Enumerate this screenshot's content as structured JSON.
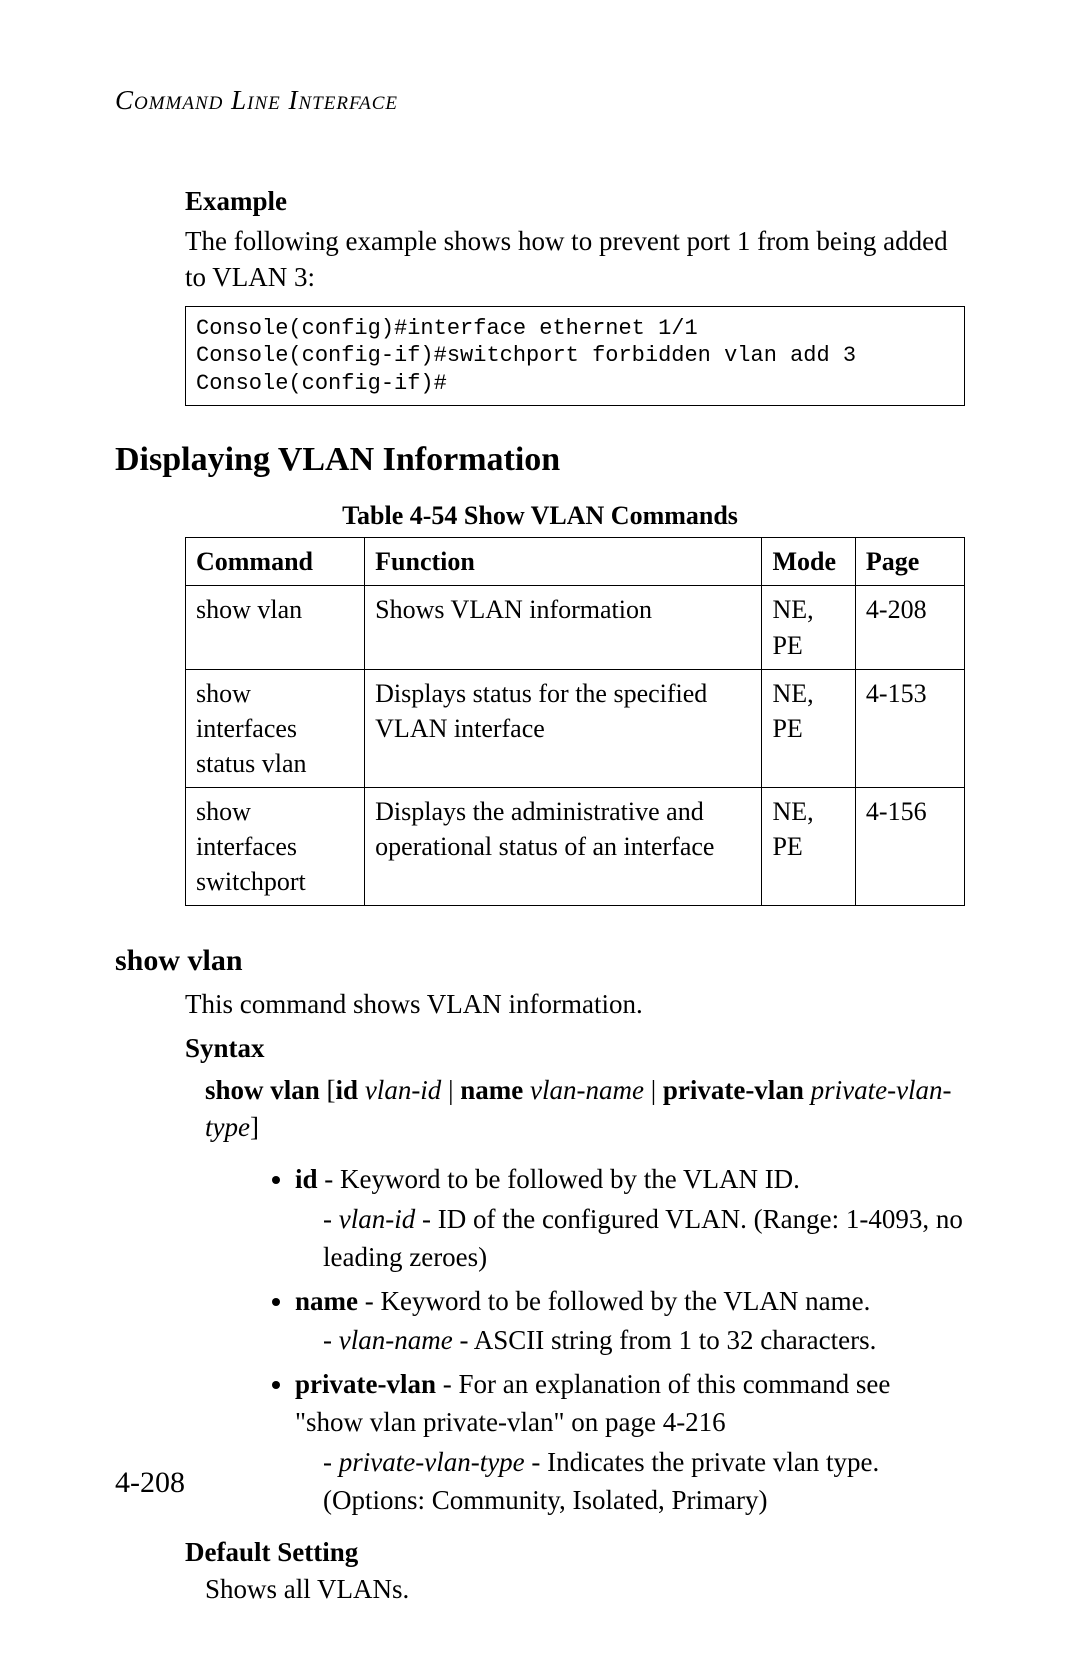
{
  "running_head": "Command Line Interface",
  "example": {
    "heading": "Example",
    "intro": "The following example shows how to prevent port 1 from being added to VLAN 3:",
    "code": "Console(config)#interface ethernet 1/1\nConsole(config-if)#switchport forbidden vlan add 3\nConsole(config-if)#"
  },
  "section_title": "Displaying VLAN Information",
  "table": {
    "caption": "Table 4-54  Show VLAN Commands",
    "headers": {
      "c0": "Command",
      "c1": "Function",
      "c2": "Mode",
      "c3": "Page"
    },
    "rows": [
      {
        "c0": "show vlan",
        "c1": "Shows VLAN information",
        "c2": "NE, PE",
        "c3": "4-208"
      },
      {
        "c0": "show interfaces status vlan",
        "c1": "Displays status for the specified VLAN interface",
        "c2": "NE, PE",
        "c3": "4-153"
      },
      {
        "c0": "show interfaces switchport",
        "c1": "Displays the administrative and operational status of an interface",
        "c2": "NE, PE",
        "c3": "4-156"
      }
    ]
  },
  "show_vlan": {
    "heading": "show vlan",
    "desc": "This command shows VLAN information.",
    "syntax_heading": "Syntax",
    "syntax": {
      "p1": "show vlan",
      "p2": " [",
      "p3": "id",
      "p4": " ",
      "p5": "vlan-id",
      "p6": " | ",
      "p7": "name",
      "p8": " ",
      "p9": "vlan-name",
      "p10": " | ",
      "p11": "private-vlan",
      "p12": " ",
      "p13": "private-vlan-type",
      "p14": "]"
    },
    "bullets": {
      "id_kw": "id",
      "id_txt": " - Keyword to be followed by the VLAN ID.",
      "vlan_id_kw": "vlan-id",
      "vlan_id_txt": " - ID of the configured VLAN. (Range: 1-4093, no leading zeroes)",
      "name_kw": "name",
      "name_txt": " - Keyword to be followed by the VLAN name.",
      "vlan_name_kw": "vlan-name",
      "vlan_name_txt": " - ASCII string from 1 to 32 characters.",
      "pv_kw": "private-vlan",
      "pv_txt": " - For an explanation of this command see \"show vlan private-vlan\" on page 4-216",
      "pvtype_kw": "private-vlan-type",
      "pvtype_txt": " - Indicates the private vlan type. (Options: Community, Isolated, Primary)"
    },
    "default_heading": "Default Setting",
    "default_body": "Shows all VLANs."
  },
  "page_number": "4-208",
  "chart_data": {
    "type": "table",
    "title": "Table 4-54  Show VLAN Commands",
    "columns": [
      "Command",
      "Function",
      "Mode",
      "Page"
    ],
    "rows": [
      [
        "show vlan",
        "Shows VLAN information",
        "NE, PE",
        "4-208"
      ],
      [
        "show interfaces status vlan",
        "Displays status for the specified VLAN interface",
        "NE, PE",
        "4-153"
      ],
      [
        "show interfaces switchport",
        "Displays the administrative and operational status of an interface",
        "NE, PE",
        "4-156"
      ]
    ]
  }
}
